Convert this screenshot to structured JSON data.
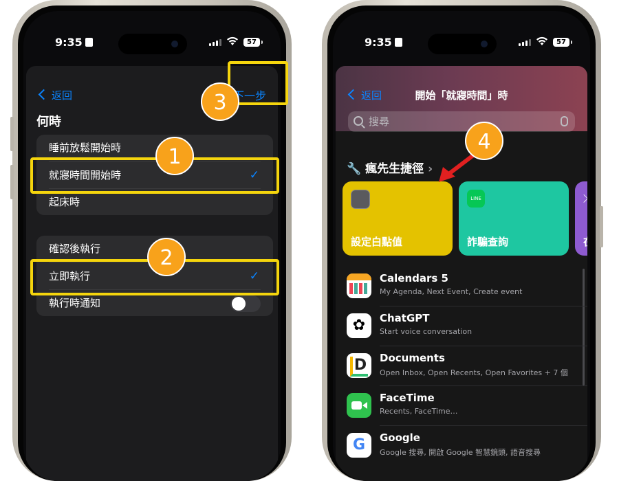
{
  "left_phone": {
    "status": {
      "time": "9:35",
      "battery": "57"
    },
    "nav": {
      "back_label": "返回",
      "next_label": "下一步"
    },
    "section_title": "何時",
    "when_options": [
      "睡前放鬆開始時",
      "就寢時間開始時",
      "起床時"
    ],
    "run_options": [
      "確認後執行",
      "立即執行"
    ],
    "notify_label": "執行時通知",
    "notify_enabled": false
  },
  "right_phone": {
    "status": {
      "time": "9:35",
      "battery": "57"
    },
    "nav": {
      "back_label": "返回",
      "title": "開始「就寢時間」時"
    },
    "search": {
      "placeholder": "搜尋"
    },
    "shortcuts_header": "瘋先生捷徑",
    "tiles": [
      {
        "label": "設定白點值",
        "color": "#e4c200"
      },
      {
        "label": "詐騙查詢",
        "color": "#1ec7a1"
      },
      {
        "label": "在",
        "color": "#8e5bd0"
      }
    ],
    "apps": [
      {
        "name": "Calendars 5",
        "sub": "My Agenda, Next Event, Create event"
      },
      {
        "name": "ChatGPT",
        "sub": "Start voice conversation"
      },
      {
        "name": "Documents",
        "sub": "Open Inbox, Open Recents, Open Favorites + 7 個"
      },
      {
        "name": "FaceTime",
        "sub": "Recents, FaceTime…"
      },
      {
        "name": "Google",
        "sub": "Google 搜尋, 開啟 Google 智慧鏡頭, 語音搜尋"
      }
    ]
  },
  "annotations": [
    "1",
    "2",
    "3",
    "4"
  ],
  "colors": {
    "highlight": "#f5d50d",
    "badge": "#f8a21b",
    "accent": "#0a84ff"
  }
}
